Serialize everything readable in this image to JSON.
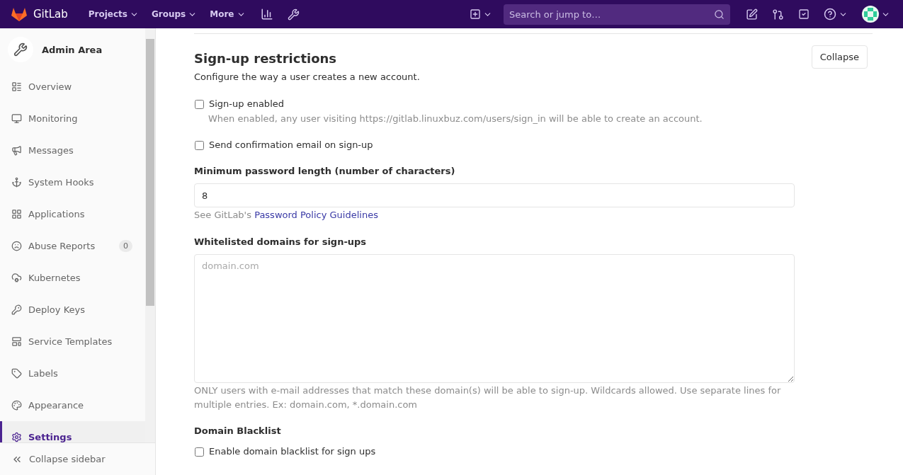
{
  "navbar": {
    "brand": "GitLab",
    "menus": [
      {
        "label": "Projects"
      },
      {
        "label": "Groups"
      },
      {
        "label": "More"
      }
    ],
    "search": {
      "placeholder": "Search or jump to…"
    }
  },
  "sidebar": {
    "title": "Admin Area",
    "items": [
      {
        "label": "Overview",
        "selected": false
      },
      {
        "label": "Monitoring",
        "selected": false
      },
      {
        "label": "Messages",
        "selected": false
      },
      {
        "label": "System Hooks",
        "selected": false
      },
      {
        "label": "Applications",
        "selected": false
      },
      {
        "label": "Abuse Reports",
        "selected": false,
        "badge": "0"
      },
      {
        "label": "Kubernetes",
        "selected": false
      },
      {
        "label": "Deploy Keys",
        "selected": false
      },
      {
        "label": "Service Templates",
        "selected": false
      },
      {
        "label": "Labels",
        "selected": false
      },
      {
        "label": "Appearance",
        "selected": false
      },
      {
        "label": "Settings",
        "selected": true
      }
    ],
    "collapse": "Collapse sidebar"
  },
  "section": {
    "title": "Sign-up restrictions",
    "description": "Configure the way a user creates a new account.",
    "collapse_button": "Collapse",
    "rows": [
      {
        "kind": "checkbox",
        "label": "Sign-up enabled",
        "checked": false,
        "help": "When enabled, any user visiting https://gitlab.linuxbuz.com/users/sign_in will be able to create an account."
      },
      {
        "kind": "checkbox",
        "label": "Send confirmation email on sign-up",
        "checked": false
      },
      {
        "kind": "input",
        "label": "Minimum password length (number of characters)",
        "value": "8",
        "help_prefix": "See GitLab's",
        "help_link": "Password Policy Guidelines"
      },
      {
        "kind": "textarea",
        "label": "Whitelisted domains for sign-ups",
        "placeholder": "domain.com",
        "help": "ONLY users with e-mail addresses that match these domain(s) will be able to sign-up. Wildcards allowed. Use separate lines for multiple entries. Ex: domain.com, *.domain.com"
      },
      {
        "kind": "heading",
        "label": "Domain Blacklist"
      },
      {
        "kind": "checkbox",
        "label": "Enable domain blacklist for sign ups",
        "checked": false
      }
    ]
  }
}
